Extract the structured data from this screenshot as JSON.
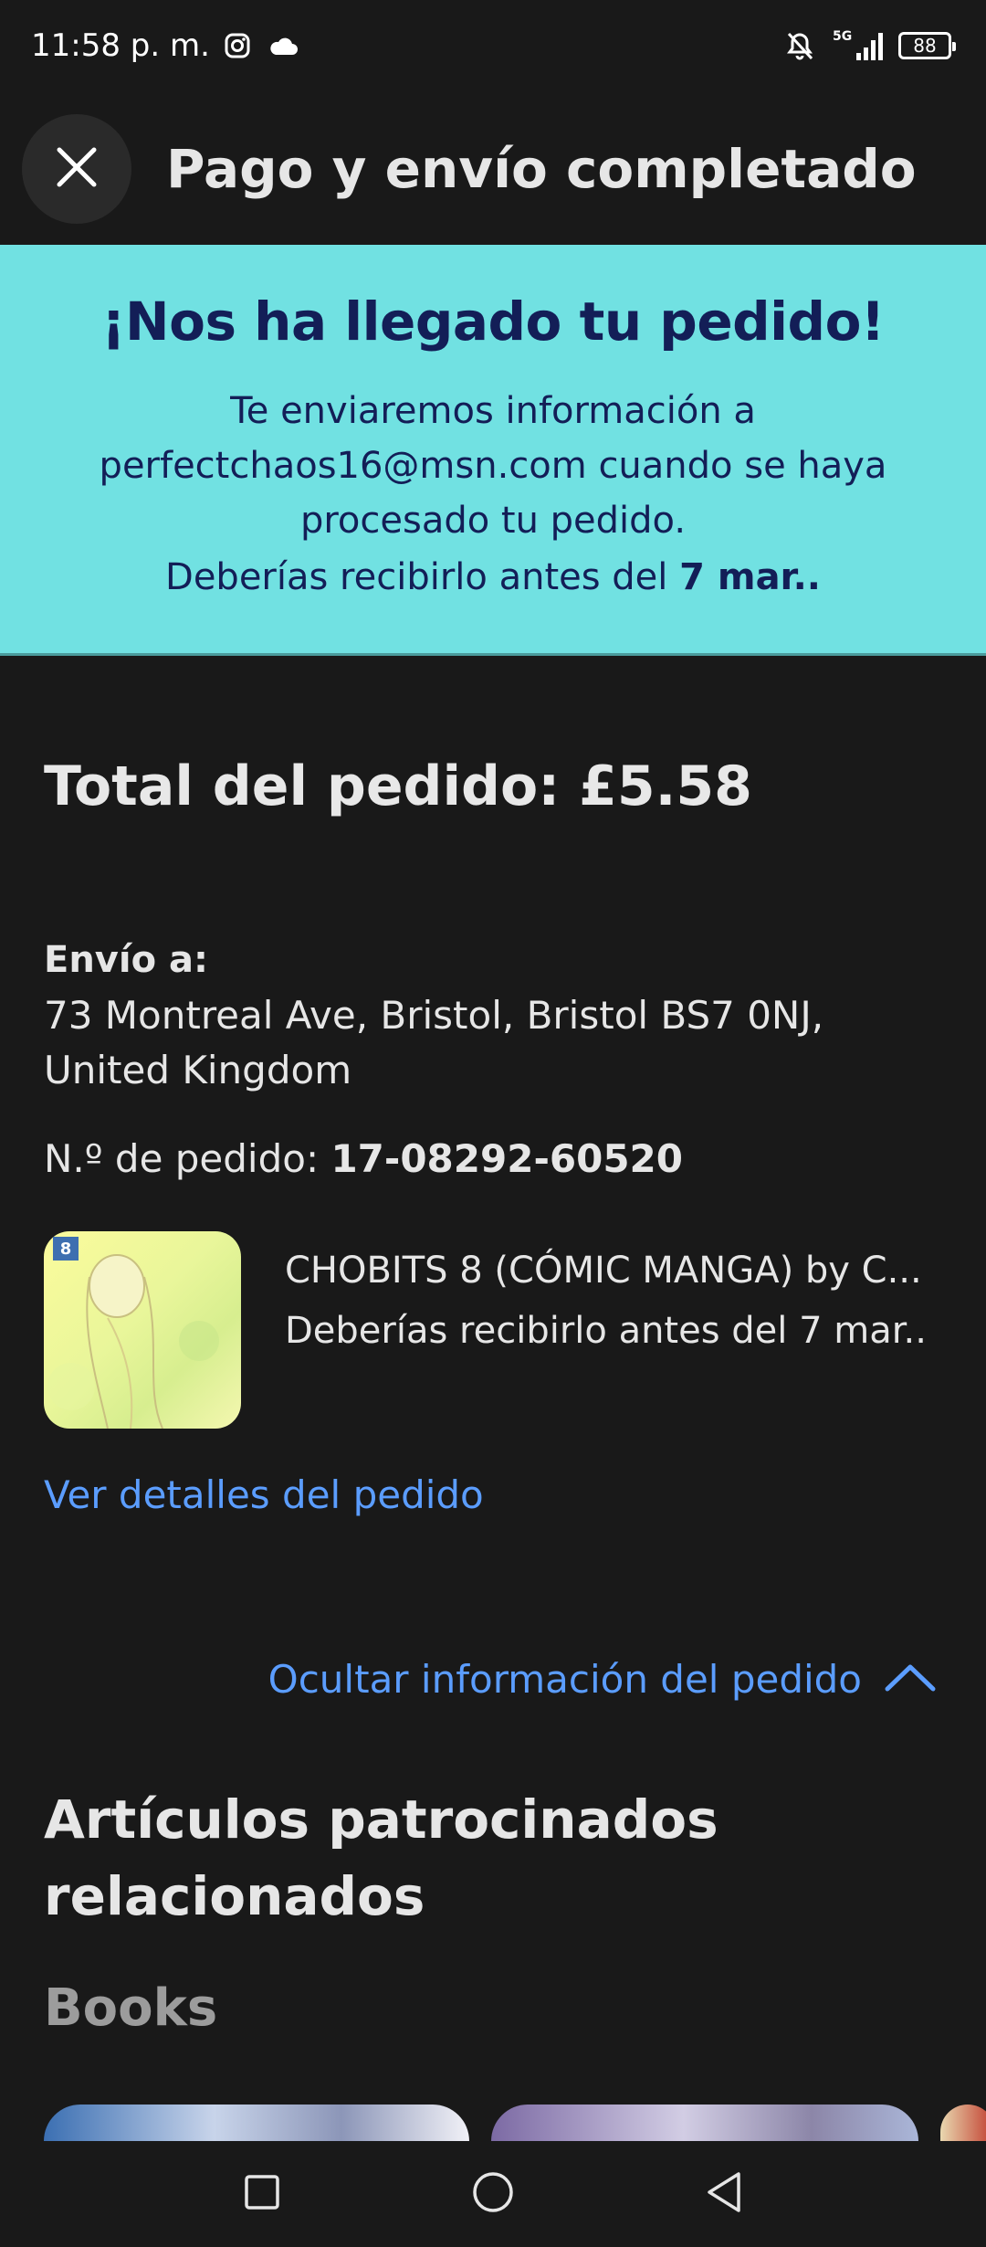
{
  "status_bar": {
    "time": "11:58 p. m.",
    "network": "5G",
    "battery": "88"
  },
  "header": {
    "title": "Pago y envío completado"
  },
  "banner": {
    "title": "¡Nos ha llegado tu pedido!",
    "body": "Te enviaremos información a perfectchaos16@msn.com cuando se haya procesado tu pedido.",
    "date_prefix": "Deberías recibirlo antes del ",
    "date_value": "7 mar.."
  },
  "order": {
    "total": "Total del pedido: £5.58",
    "ship_label": "Envío a:",
    "ship_address": "73 Montreal Ave, Bristol, Bristol BS7 0NJ, United Kingdom",
    "number_label": "N.º de pedido: ",
    "number_value": "17-08292-60520",
    "item": {
      "badge": "8",
      "title": "CHOBITS 8 (CÓMIC MANGA) by C...",
      "delivery": "Deberías recibirlo antes del 7 mar.."
    },
    "details_link": "Ver detalles del pedido",
    "hide_link": "Ocultar información del pedido"
  },
  "sponsored": {
    "title": "Artículos patrocinados relacionados",
    "category": "Books"
  },
  "colors": {
    "background": "#191919",
    "banner": "#71e1e2",
    "banner_text": "#131e57",
    "link": "#5b9dff"
  },
  "icons": {
    "close": "close-icon",
    "chevron": "chevron-up-icon",
    "nav": [
      "recents-square-icon",
      "home-circle-icon",
      "back-triangle-icon"
    ]
  }
}
